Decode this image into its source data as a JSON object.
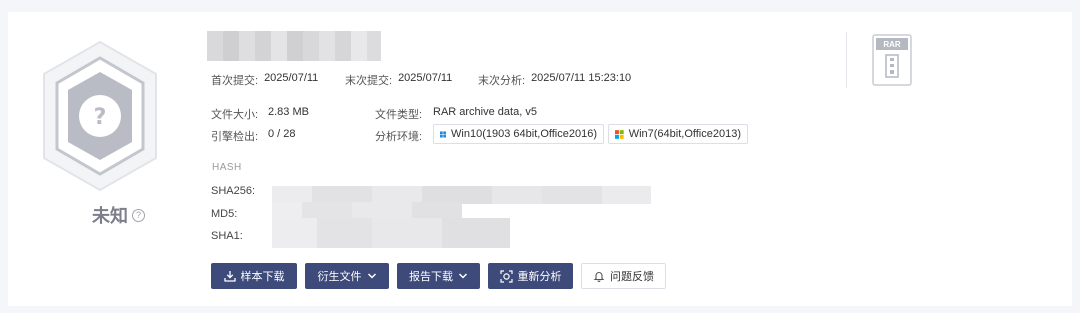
{
  "verdict": {
    "label": "未知",
    "badge_symbol": "?",
    "badge_color": "#b9bcc4"
  },
  "dates": {
    "first_submit_label": "首次提交:",
    "first_submit_value": "2025/07/11",
    "last_submit_label": "末次提交:",
    "last_submit_value": "2025/07/11",
    "last_analysis_label": "末次分析:",
    "last_analysis_value": "2025/07/11 15:23:10"
  },
  "file_info": {
    "size_label": "文件大小:",
    "size_value": "2.83 MB",
    "engine_label": "引擎检出:",
    "engine_value": "0 / 28",
    "type_label": "文件类型:",
    "type_value": "RAR archive data, v5",
    "env_label": "分析环境:"
  },
  "environments": [
    {
      "label": "Win10(1903 64bit,Office2016)",
      "icon": "windows10-icon"
    },
    {
      "label": "Win7(64bit,Office2013)",
      "icon": "windows7-icon"
    }
  ],
  "hash": {
    "title": "HASH",
    "sha256_label": "SHA256:",
    "md5_label": "MD5:",
    "sha1_label": "SHA1:"
  },
  "actions": [
    {
      "label": "样本下载",
      "icon": "download-icon"
    },
    {
      "label": "衍生文件",
      "icon": "chevron-down-icon"
    },
    {
      "label": "报告下载",
      "icon": "chevron-down-icon"
    },
    {
      "label": "重新分析",
      "icon": "reanalyze-icon"
    },
    {
      "label": "问题反馈",
      "icon": "bell-icon"
    }
  ],
  "file_type_icon": {
    "label": "RAR",
    "icon": "rar-file-icon"
  },
  "colors": {
    "primary": "#3d4a7a",
    "muted": "#7c7f8a",
    "border": "#dcdfe6"
  }
}
